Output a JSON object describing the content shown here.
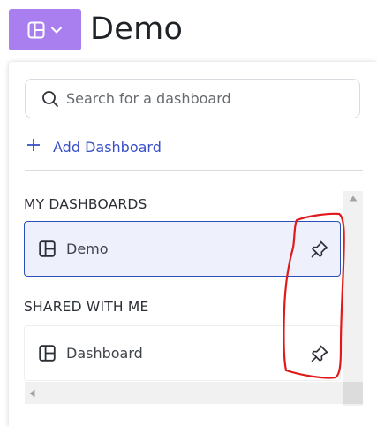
{
  "header": {
    "title": "Demo",
    "switcher_icon": "dashboard-layout-icon",
    "switcher_chevron": "chevron-down-icon",
    "accent_color": "#a97ff0"
  },
  "search": {
    "placeholder": "Search for a dashboard",
    "value": "",
    "icon": "search-icon"
  },
  "actions": {
    "add_dashboard_label": "Add Dashboard",
    "add_icon": "plus-icon",
    "link_color": "#3a50c7"
  },
  "sections": {
    "my_dashboards": {
      "heading": "MY DASHBOARDS",
      "items": [
        {
          "label": "Demo",
          "icon": "dashboard-layout-icon",
          "pin_icon": "pin-icon",
          "selected": true
        }
      ]
    },
    "shared_with_me": {
      "heading": "SHARED WITH ME",
      "items": [
        {
          "label": "Dashboard",
          "icon": "dashboard-layout-icon",
          "pin_icon": "pin-icon",
          "selected": false
        }
      ]
    }
  },
  "annotation": {
    "color": "#e0191b",
    "shape": "hand-drawn-outline-around-pin-icons"
  }
}
